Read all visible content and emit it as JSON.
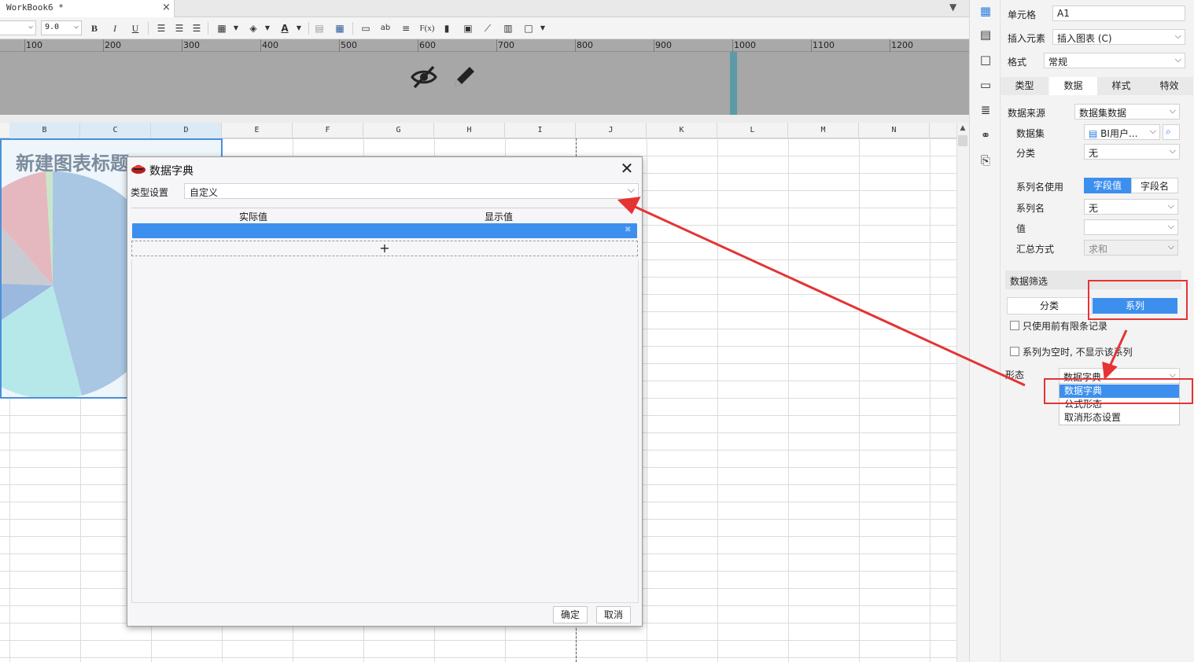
{
  "tab": {
    "label": "WorkBook6 *",
    "close": "×",
    "menu": "▼"
  },
  "toolbar": {
    "font_name": "",
    "font_size": "9.0",
    "bold": "B",
    "italic": "I",
    "underline": "U",
    "wrap": "ab",
    "formula": "F(x)"
  },
  "ruler": {
    "labels": [
      "100",
      "200",
      "300",
      "400",
      "500",
      "600",
      "700",
      "800",
      "900",
      "1000",
      "1100",
      "1200"
    ]
  },
  "columns": [
    "B",
    "C",
    "D",
    "E",
    "F",
    "G",
    "H",
    "I",
    "J",
    "K",
    "L",
    "M",
    "N"
  ],
  "chart": {
    "title": "新建图表标题"
  },
  "dialog": {
    "title": "数据字典",
    "type_label": "类型设置",
    "type_value": "自定义",
    "col_actual": "实际值",
    "col_display": "显示值",
    "add": "+",
    "ok": "确定",
    "cancel": "取消"
  },
  "panel": {
    "cell_label": "单元格",
    "cell_value": "A1",
    "insert_label": "插入元素",
    "insert_value": "插入图表 (C)",
    "format_label": "格式",
    "format_value": "常规",
    "tabs": [
      "类型",
      "数据",
      "样式",
      "特效"
    ],
    "source_label": "数据来源",
    "source_value": "数据集数据",
    "dataset_label": "数据集",
    "dataset_value": "BI用户...",
    "category_label": "分类",
    "category_value": "无",
    "series_name_use_label": "系列名使用",
    "series_name_use_field_value": "字段值",
    "series_name_use_field_name": "字段名",
    "series_name_label": "系列名",
    "series_name_value": "无",
    "value_label": "值",
    "value_value": "",
    "summary_label": "汇总方式",
    "summary_value": "求和",
    "filter_section": "数据筛选",
    "filter_category": "分类",
    "filter_series": "系列",
    "check_limited": "只使用前有限条记录",
    "check_hide_empty": "系列为空时, 不显示该系列",
    "form_label": "形态",
    "form_value": "数据字典",
    "form_options": [
      "数据字典",
      "公式形态",
      "取消形态设置"
    ]
  },
  "colors": {
    "accent": "#3d8fee",
    "annotation": "#e53333"
  }
}
